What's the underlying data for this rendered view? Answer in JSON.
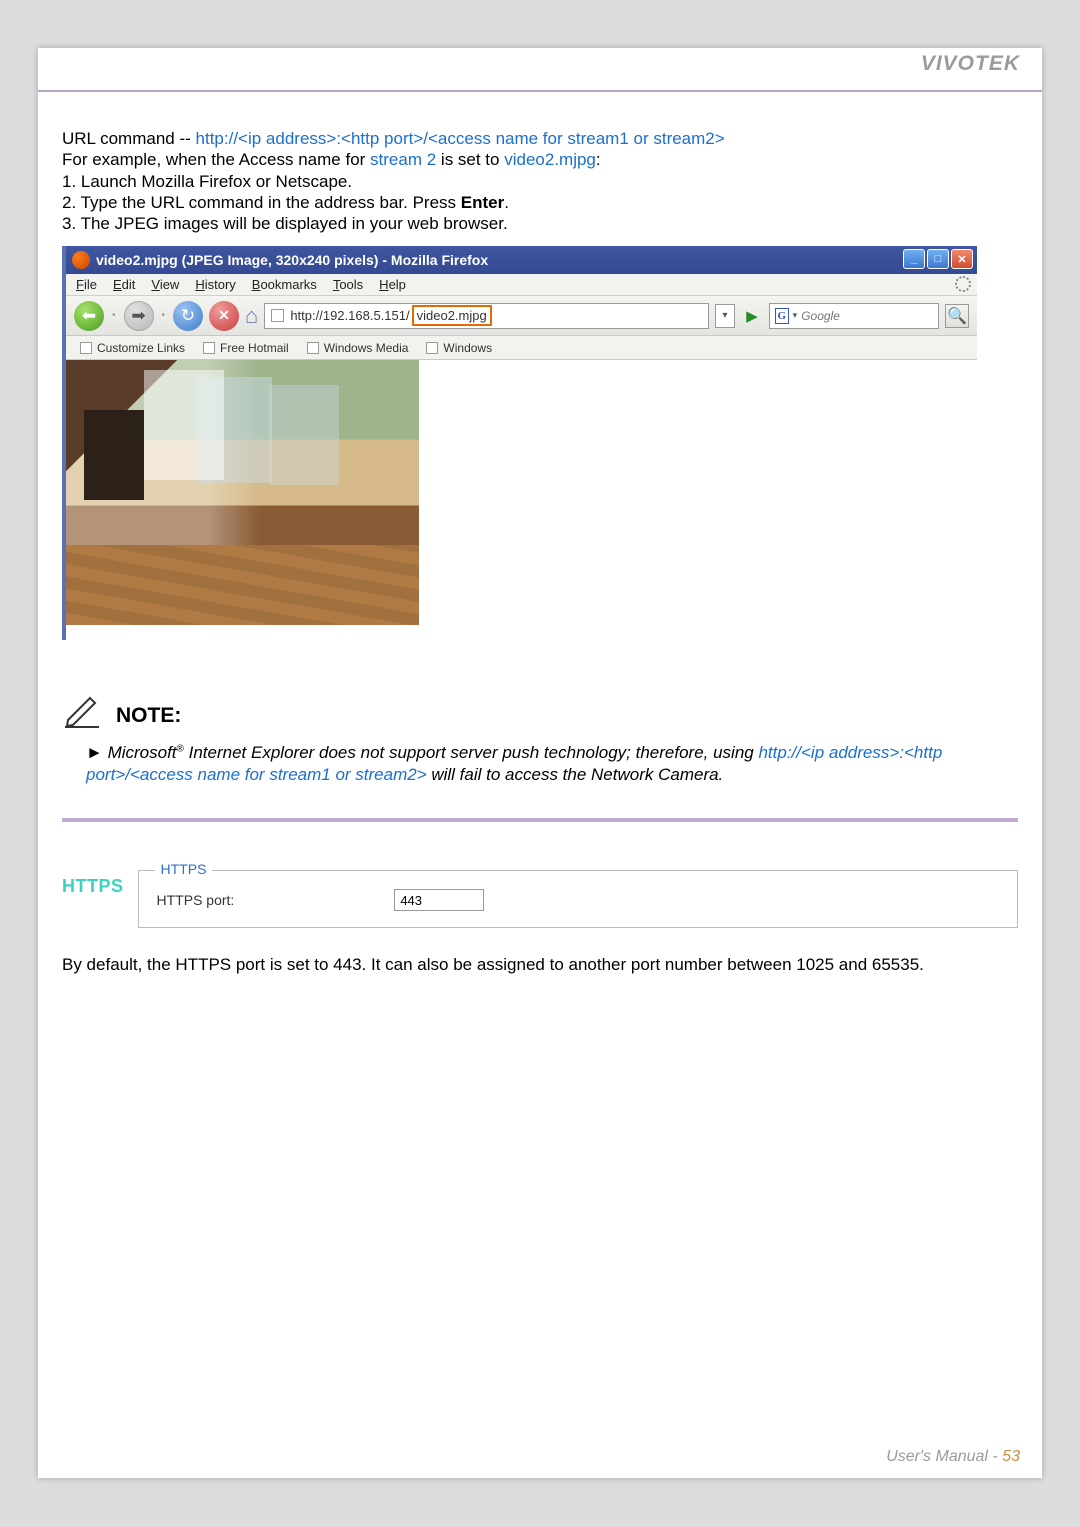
{
  "header": {
    "brand": "VIVOTEK"
  },
  "url_section": {
    "prefix": "URL command -- ",
    "url_pattern": "http://<ip address>:<http port>/<access name for stream1 or stream2>",
    "example_line_1": "For example, when the Access name for ",
    "stream_label": "stream 2",
    "example_line_2": " is set to ",
    "mjpg": "video2.mjpg",
    "colon": ":",
    "step1": "1. Launch Mozilla Firefox or Netscape.",
    "step2a": "2. Type the URL command in the address bar. Press ",
    "step2b": "Enter",
    "step2c": ".",
    "step3": "3. The JPEG images will be displayed in your web browser."
  },
  "firefox": {
    "title": "video2.mjpg (JPEG Image, 320x240 pixels) - Mozilla Firefox",
    "menus": [
      "File",
      "Edit",
      "View",
      "History",
      "Bookmarks",
      "Tools",
      "Help"
    ],
    "address_prefix": "http://192.168.5.151/",
    "address_highlight": "video2.mjpg",
    "search_placeholder": "Google",
    "bookmarks": [
      "Customize Links",
      "Free Hotmail",
      "Windows Media",
      "Windows"
    ],
    "winbuttons": {
      "min": "_",
      "max": "□",
      "close": "✕"
    },
    "nav": {
      "back": "⬅",
      "fwd": "➡",
      "reload": "↻",
      "stop": "✕",
      "home": "⌂",
      "go": "▶",
      "drop": "▾",
      "mag": "🔍",
      "gdrop": "▾"
    }
  },
  "note": {
    "title": "NOTE:",
    "arrow": "►",
    "text1": "Microsoft",
    "reg": "®",
    "text2": " Internet Explorer does not support server push technology; therefore, using ",
    "blue_part": "http://<ip address>:<http port>/<access name for stream1 or stream2>",
    "text3": " will fail to access the Network Camera."
  },
  "https": {
    "heading": "HTTPS",
    "legend": "HTTPS",
    "port_label": "HTTPS port:",
    "port_value": "443",
    "description": "By default, the HTTPS port is set to 443. It can also be assigned to another port number between 1025 and 65535."
  },
  "footer": {
    "label": "User's Manual - ",
    "page": "53"
  }
}
